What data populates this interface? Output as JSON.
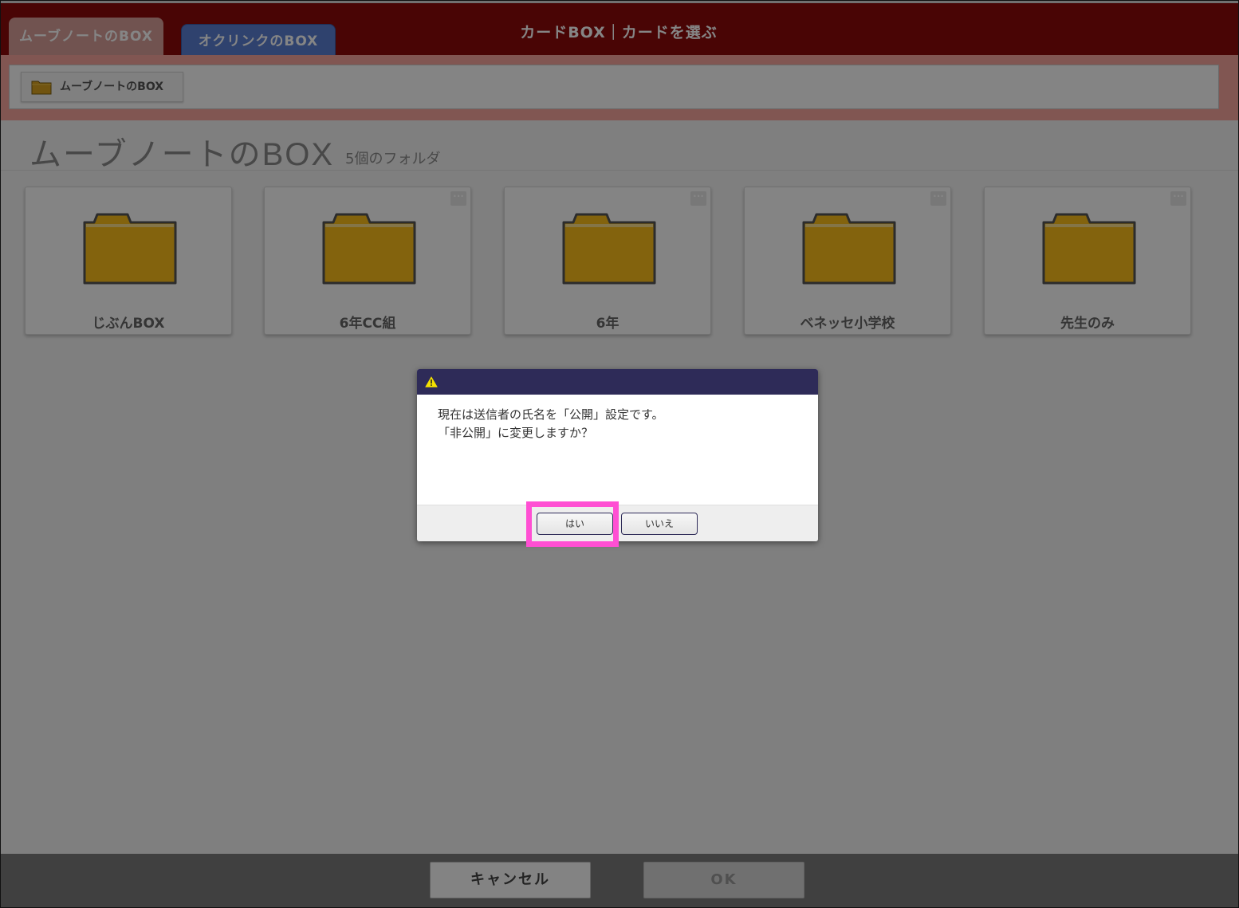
{
  "header": {
    "tabs": [
      {
        "label": "ムーブノートのBOX",
        "active": true
      },
      {
        "label": "オクリンクのBOX",
        "active": false
      }
    ],
    "title": "カードBOX｜カードを選ぶ"
  },
  "breadcrumb": {
    "label": "ムーブノートのBOX",
    "icon": "folder-icon"
  },
  "page": {
    "title": "ムーブノートのBOX",
    "folder_count": "5個のフォルダ"
  },
  "folders": [
    {
      "label": "じぶんBOX",
      "has_menu": false
    },
    {
      "label": "6年CC組",
      "has_menu": true
    },
    {
      "label": "6年",
      "has_menu": true
    },
    {
      "label": "ベネッセ小学校",
      "has_menu": true
    },
    {
      "label": "先生のみ",
      "has_menu": true
    }
  ],
  "footer": {
    "cancel_label": "キャンセル",
    "ok_label": "OK"
  },
  "dialog": {
    "icon": "warning-icon",
    "message_line1": "現在は送信者の氏名を「公開」設定です。",
    "message_line2": "「非公開」に変更しますか？",
    "yes_label": "はい",
    "no_label": "いいえ"
  },
  "colors": {
    "header_bg": "#8d0b0b",
    "folder": "#c89a1a",
    "dialog_header": "#2e2b58",
    "highlight": "#ff4fd3"
  }
}
